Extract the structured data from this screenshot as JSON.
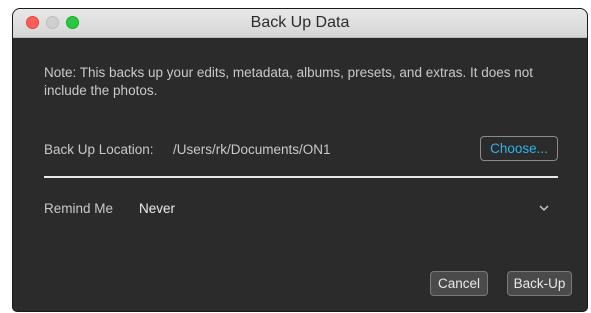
{
  "window": {
    "title": "Back Up Data"
  },
  "note": {
    "text": "Note: This backs up your edits, metadata, albums, presets, and extras. It does not include the photos."
  },
  "backup_location": {
    "label": "Back Up Location:",
    "path": "/Users/rk/Documents/ON1",
    "choose_label": "Choose..."
  },
  "remind": {
    "label": "Remind Me",
    "selected": "Never"
  },
  "buttons": {
    "cancel": "Cancel",
    "backup": "Back-Up"
  },
  "colors": {
    "accent": "#2fb3e8",
    "close": "#ff5f57",
    "minimize": "#cfcfcf",
    "maximize": "#28c940",
    "background": "#2b2b2b"
  }
}
